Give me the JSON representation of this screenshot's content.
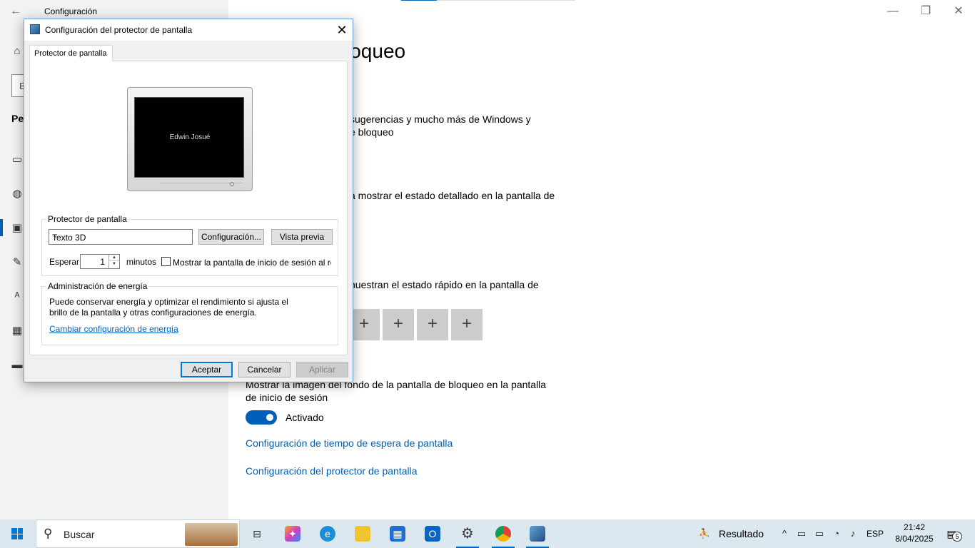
{
  "settings": {
    "app_title": "Configuración",
    "search_placeholder": "B",
    "section_label": "Per",
    "heading_fragment": "loqueo",
    "para1": [
      "sugerencias y mucho más de Windows y",
      "e bloqueo"
    ],
    "para2": "a mostrar el estado detallado en la pantalla de",
    "para3": "nuestran el estado rápido en la pantalla de",
    "quick_tile_glyph": "+",
    "background_setting": [
      "Mostrar la imagen del fondo de la pantalla de bloqueo en la pantalla",
      "de inicio de sesión"
    ],
    "toggle_label": "Activado",
    "toggle_on": true,
    "links": [
      "Configuración de tiempo de espera de pantalla",
      "Configuración del protector de pantalla"
    ],
    "window_controls": {
      "minimize": "—",
      "maximize": "❐",
      "close": "✕"
    }
  },
  "dialog": {
    "title": "Configuración del protector de pantalla",
    "close": "✕",
    "tab": "Protector de pantalla",
    "preview_text": "Edwin Josué",
    "saver_group": "Protector de pantalla",
    "saver_selected": "Texto 3D",
    "config_button": "Configuración...",
    "preview_button": "Vista previa",
    "wait_label": "Esperar:",
    "wait_value": "1",
    "minutes_label": "minutos",
    "logon_checkbox": "Mostrar la pantalla de inicio de sesión al re",
    "logon_checked": false,
    "energy_group": "Administración de energía",
    "energy_text": "Puede conservar energía y optimizar el rendimiento si ajusta el brillo de la pantalla y otras configuraciones de energía.",
    "energy_link": "Cambiar configuración de energía",
    "ok": "Aceptar",
    "cancel": "Cancelar",
    "apply": "Aplicar"
  },
  "taskbar": {
    "search_label": "Buscar",
    "weather_text": "Resultado",
    "language": "ESP",
    "time": "21:42",
    "date": "8/04/2025",
    "notification_count": "5"
  }
}
